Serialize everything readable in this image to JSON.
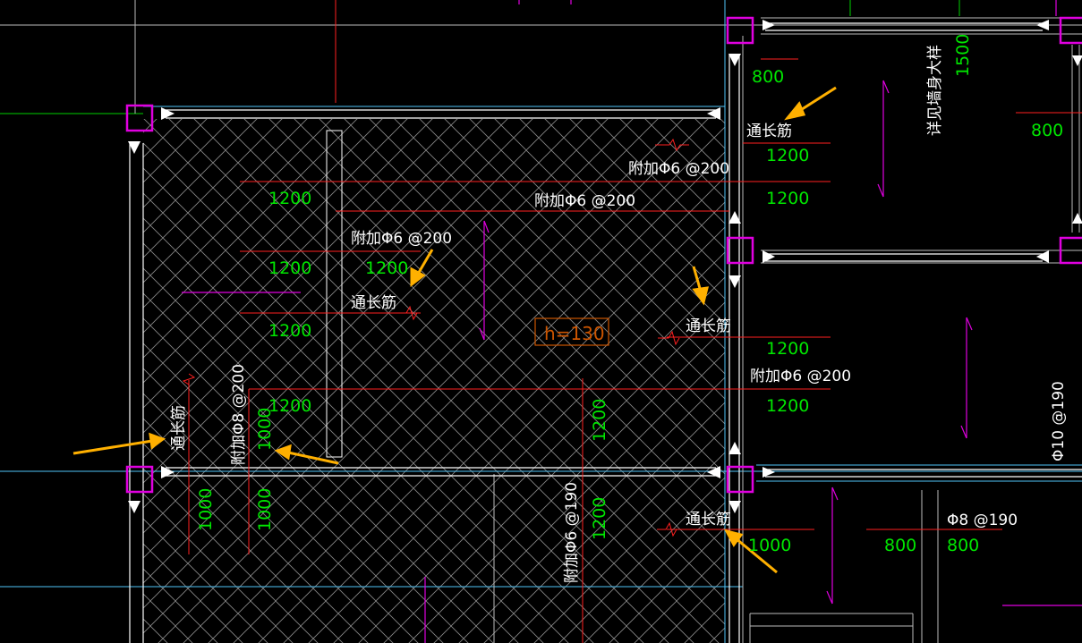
{
  "colors": {
    "background": "#000000",
    "column_marker": "#e000e0",
    "beam_line": "#ffffff",
    "axis_line": "#4fc3f7",
    "rebar_red": "#ff2020",
    "dimension_green": "#00e600",
    "label_white": "#ffffff",
    "arrow_orange": "#ffb000",
    "hatch": "#b0b0b0",
    "text_box": "#cc5500"
  },
  "annotations": {
    "through_bar": "通长筋",
    "additional_phi6_200": "附加Φ6 @200",
    "additional_phi8_200": "附加Φ8 @200",
    "additional_phi6_190": "附加Φ6 @190",
    "phi10_190": "Φ10 @190",
    "phi8_190": "Φ8 @190",
    "see_wall_detail": "详见墙身大样",
    "slab_thickness": "h=130"
  },
  "dimensions": {
    "d800": "800",
    "d1000": "1000",
    "d1200": "1200",
    "d1500": "1500"
  }
}
